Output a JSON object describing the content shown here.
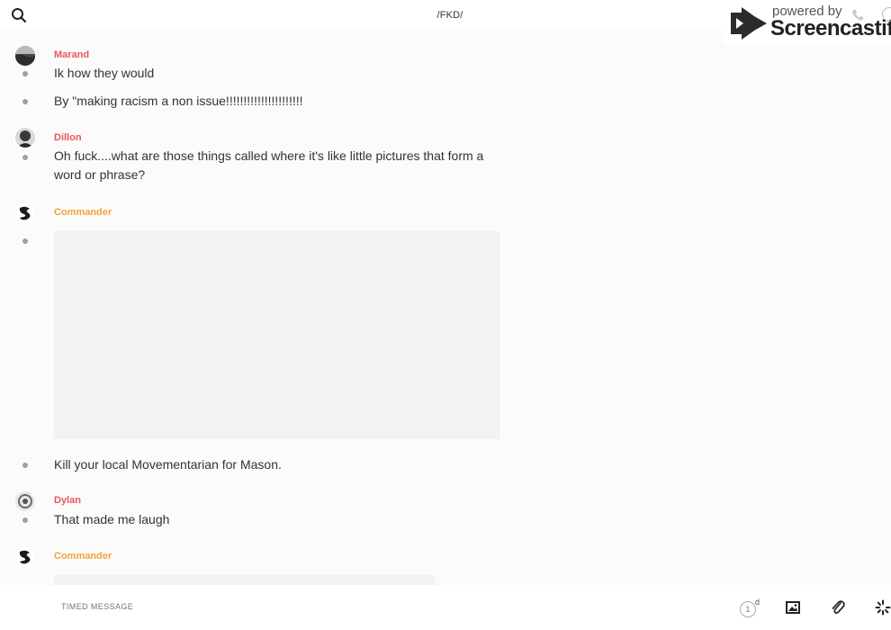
{
  "header": {
    "title": "/FKD/",
    "search_icon": "search-icon"
  },
  "watermark": {
    "powered_by": "powered by",
    "brand": "Screencastify"
  },
  "messages": [
    {
      "author": "Marand",
      "author_color": "#e9565a",
      "lines": [
        "Ik how they would",
        "By \"making racism a non issue!!!!!!!!!!!!!!!!!!!!!!"
      ]
    },
    {
      "author": "Dillon",
      "author_color": "#e9565a",
      "lines": [
        "Oh fuck....what are those things called where it's like little pictures that form a word or phrase?"
      ]
    },
    {
      "author": "Commander",
      "author_color": "#f3a33f",
      "lines": [
        "Kill your local Movementarian for Mason."
      ]
    },
    {
      "author": "Dylan",
      "author_color": "#e9565a",
      "lines": [
        "That made me laugh"
      ]
    },
    {
      "author": "Commander",
      "author_color": "#f3a33f",
      "lines": []
    }
  ],
  "composer": {
    "placeholder": "TIMED MESSAGE",
    "timer_value": "1",
    "timer_unit": "d",
    "icons": [
      "timer-icon",
      "image-icon",
      "paperclip-icon",
      "loading-icon"
    ]
  }
}
